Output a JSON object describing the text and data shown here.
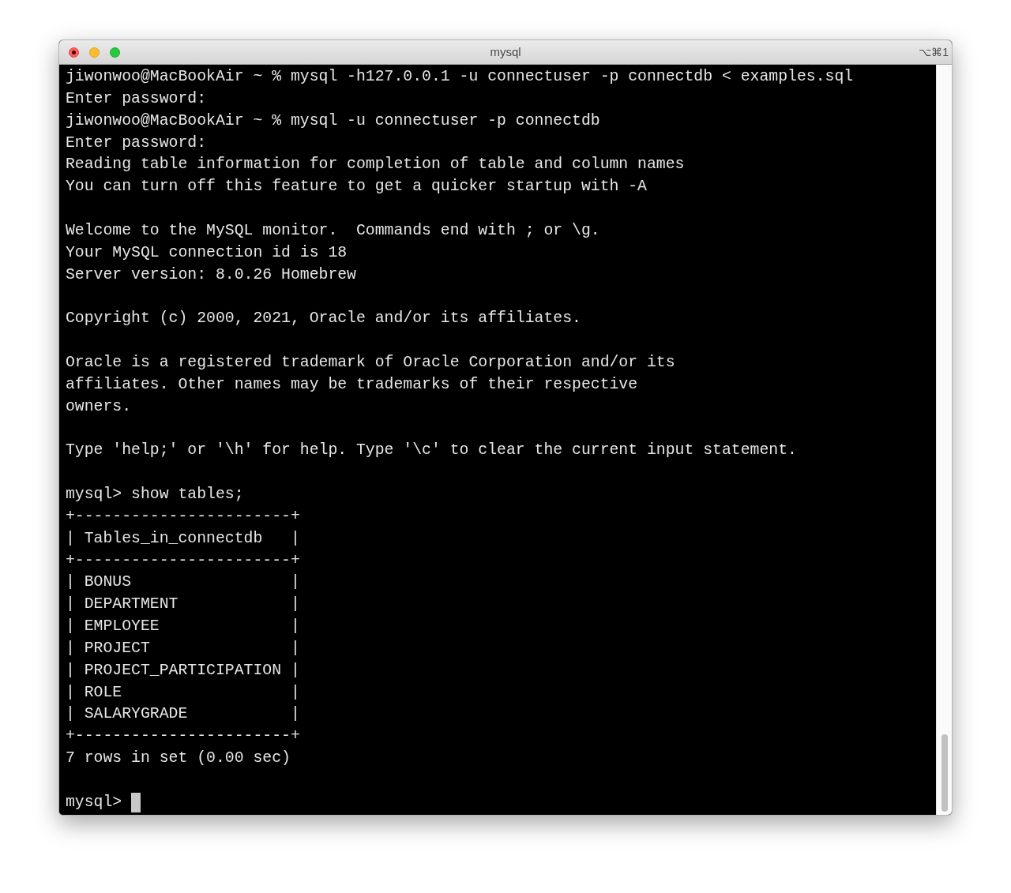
{
  "window": {
    "title": "mysql",
    "shortcut": "⌥⌘1"
  },
  "terminal": {
    "blocks": [
      [
        "jiwonwoo@MacBookAir ~ % mysql -h127.0.0.1 -u connectuser -p connectdb < examples.sql",
        "Enter password:",
        "jiwonwoo@MacBookAir ~ % mysql -u connectuser -p connectdb",
        "Enter password:",
        "Reading table information for completion of table and column names",
        "You can turn off this feature to get a quicker startup with -A"
      ],
      [
        "Welcome to the MySQL monitor.  Commands end with ; or \\g.",
        "Your MySQL connection id is 18",
        "Server version: 8.0.26 Homebrew"
      ],
      [
        "Copyright (c) 2000, 2021, Oracle and/or its affiliates."
      ],
      [
        "Oracle is a registered trademark of Oracle Corporation and/or its",
        "affiliates. Other names may be trademarks of their respective",
        "owners."
      ],
      [
        "Type 'help;' or '\\h' for help. Type '\\c' to clear the current input statement."
      ],
      [
        "mysql> show tables;",
        "+-----------------------+",
        "| Tables_in_connectdb   |",
        "+-----------------------+",
        "| BONUS                 |",
        "| DEPARTMENT            |",
        "| EMPLOYEE              |",
        "| PROJECT               |",
        "| PROJECT_PARTICIPATION |",
        "| ROLE                  |",
        "| SALARYGRADE           |",
        "+-----------------------+",
        "7 rows in set (0.00 sec)"
      ]
    ],
    "prompt": "mysql>"
  }
}
